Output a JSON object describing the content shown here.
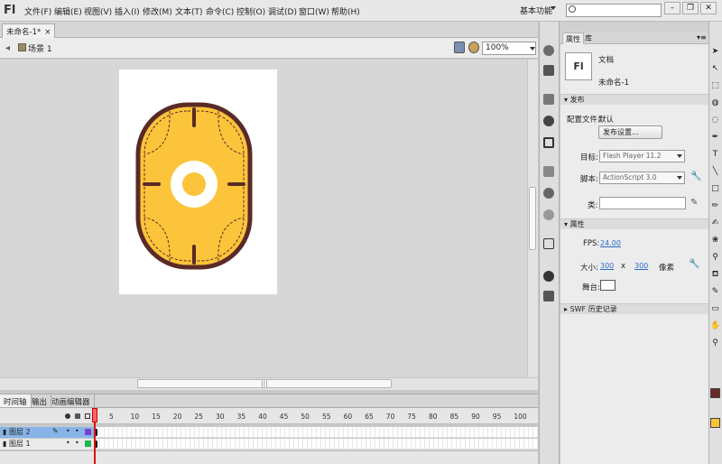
{
  "app": {
    "logo": "Fl"
  },
  "menu": [
    "文件(F)",
    "编辑(E)",
    "视图(V)",
    "插入(I)",
    "修改(M)",
    "文本(T)",
    "命令(C)",
    "控制(O)",
    "调试(D)",
    "窗口(W)",
    "帮助(H)"
  ],
  "workspace": {
    "label": "基本功能"
  },
  "search": {
    "placeholder": ""
  },
  "window_buttons": {
    "minimize": "–",
    "restore": "❐",
    "close": "✕"
  },
  "doc_tab": {
    "title": "未命名-1*",
    "close": "×"
  },
  "scene": {
    "label": "场景 1",
    "zoom": "100%"
  },
  "timeline": {
    "tabs": [
      "时间轴",
      "输出",
      "动画编辑器"
    ],
    "ruler": [
      "5",
      "10",
      "15",
      "20",
      "25",
      "30",
      "35",
      "40",
      "45",
      "50",
      "55",
      "60",
      "65",
      "70",
      "75",
      "80",
      "85",
      "90",
      "95",
      "100"
    ],
    "layers": [
      {
        "name": "图层 2",
        "selected": true,
        "color": "#7b3fc9"
      },
      {
        "name": "图层 1",
        "selected": false,
        "color": "#19b84a"
      }
    ]
  },
  "properties": {
    "tabs": [
      "属性",
      "库"
    ],
    "doc_type": "文档",
    "doc_name": "未命名-1",
    "publish_section": "发布",
    "profile_label": "配置文件:",
    "profile_value": "默认",
    "publish_settings_btn": "发布设置...",
    "target_label": "目标:",
    "target_value": "Flash Player 11.2",
    "script_label": "脚本:",
    "script_value": "ActionScript 3.0",
    "class_label": "类:",
    "props_section": "属性",
    "fps_label": "FPS:",
    "fps_value": "24.00",
    "size_label": "大小:",
    "width": "300",
    "x_sep": "x",
    "height": "300",
    "unit": "像素",
    "stage_label": "舞台:",
    "swf_section": "SWF 历史记录"
  },
  "colors": {
    "shape_fill": "#fcc43a",
    "shape_stroke": "#5a2a27",
    "stroke_swatch": "#6b2a23",
    "fill_swatch": "#fcc43a",
    "stage_color": "#ffffff"
  }
}
